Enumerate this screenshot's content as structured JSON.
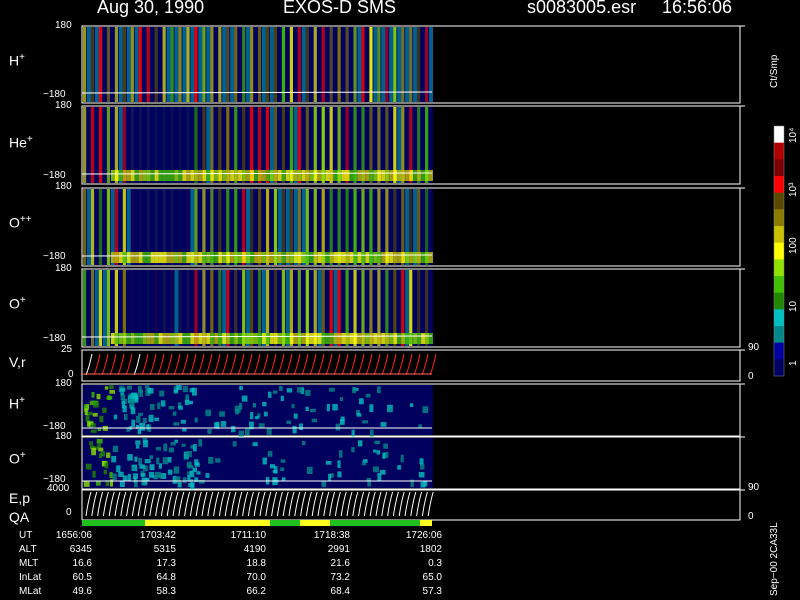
{
  "header": {
    "date": "Aug 30, 1990",
    "instrument": "EXOS-D SMS",
    "file": "s0083005.esr",
    "time": "16:56:06"
  },
  "panels": [
    {
      "name": "H",
      "sup": "+",
      "ytop": "180",
      "ybot": "−180"
    },
    {
      "name": "He",
      "sup": "+",
      "ytop": "180",
      "ybot": "−180"
    },
    {
      "name": "O",
      "sup": "++",
      "ytop": "180",
      "ybot": "−180"
    },
    {
      "name": "O",
      "sup": "+",
      "ytop": "180",
      "ybot": "−180"
    },
    {
      "name": "V,r",
      "sup": "",
      "ytop": "25",
      "ybot": "0",
      "rtop": "90",
      "rbot": "0"
    },
    {
      "name": "H",
      "sup": "+",
      "ytop": "180",
      "ybot": "−180"
    },
    {
      "name": "O",
      "sup": "+",
      "ytop": "180",
      "ybot": "−180"
    },
    {
      "name": "E,p",
      "sup": "",
      "ytop": "4000",
      "ybot": "0",
      "rtop": "90",
      "rbot": "0"
    }
  ],
  "qa_label": "QA",
  "colorbar": {
    "unit": "Ct/Smp",
    "ticks": [
      "10⁴",
      "10³",
      "100",
      "10",
      "1"
    ],
    "colors": [
      "#ffffff",
      "#b00000",
      "#7a0000",
      "#ff0000",
      "#5a4a00",
      "#8a7a00",
      "#c8c000",
      "#ffff00",
      "#90e000",
      "#40c000",
      "#208800",
      "#00c0c0",
      "#008888",
      "#0000a0",
      "#000060"
    ]
  },
  "footer": {
    "row_labels": [
      "UT",
      "ALT",
      "MLT",
      "InLat",
      "MLat"
    ],
    "columns": [
      [
        "1656:06",
        "6345",
        "16.6",
        "60.5",
        "49.6"
      ],
      [
        "1703:42",
        "5315",
        "17.3",
        "64.8",
        "58.3"
      ],
      [
        "1711:10",
        "4190",
        "18.8",
        "70.0",
        "66.2"
      ],
      [
        "1718:38",
        "2991",
        "21.6",
        "73.2",
        "68.4"
      ],
      [
        "1726:06",
        "1802",
        "0.3",
        "65.0",
        "57.3"
      ]
    ]
  },
  "side_note": "Sep−00 2CA33L",
  "chart_data": {
    "type": "heatmap",
    "x_axis": "UT",
    "x_ticks": [
      "1656:06",
      "1703:42",
      "1711:10",
      "1718:38",
      "1726:06"
    ],
    "color_scale": "log",
    "color_unit": "Ct/Smp",
    "color_ticks": [
      "1",
      "10",
      "100",
      "10³",
      "10⁴"
    ],
    "panels": [
      {
        "label": "H+",
        "ylim": [
          -180,
          180
        ]
      },
      {
        "label": "He+",
        "ylim": [
          -180,
          180
        ]
      },
      {
        "label": "O++",
        "ylim": [
          -180,
          180
        ]
      },
      {
        "label": "O+",
        "ylim": [
          -180,
          180
        ]
      },
      {
        "label": "V,r",
        "ylim": [
          0,
          25
        ],
        "right_ylim": [
          0,
          90
        ]
      },
      {
        "label": "H+",
        "ylim": [
          -180,
          180
        ]
      },
      {
        "label": "O+",
        "ylim": [
          -180,
          180
        ]
      },
      {
        "label": "E,p",
        "ylim": [
          0,
          4000
        ],
        "right_ylim": [
          0,
          90
        ]
      }
    ]
  }
}
